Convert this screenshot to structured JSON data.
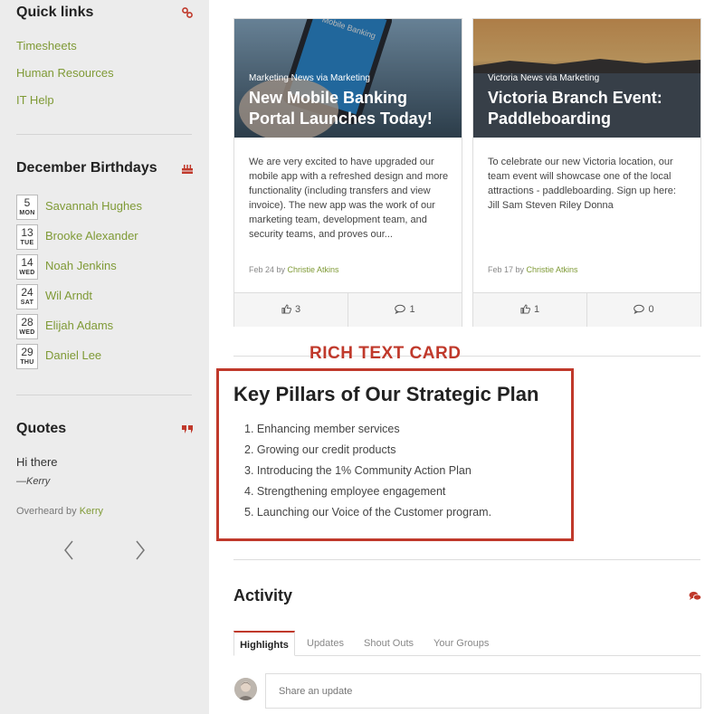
{
  "sidebar": {
    "quick_links": {
      "heading": "Quick links",
      "links": [
        "Timesheets",
        "Human Resources",
        "IT Help"
      ]
    },
    "birthdays": {
      "heading": "December Birthdays",
      "people": [
        {
          "day": "5",
          "weekday": "MON",
          "name": "Savannah Hughes"
        },
        {
          "day": "13",
          "weekday": "TUE",
          "name": "Brooke Alexander"
        },
        {
          "day": "14",
          "weekday": "WED",
          "name": "Noah Jenkins"
        },
        {
          "day": "24",
          "weekday": "SAT",
          "name": "Wil Arndt"
        },
        {
          "day": "28",
          "weekday": "WED",
          "name": "Elijah Adams"
        },
        {
          "day": "29",
          "weekday": "THU",
          "name": "Daniel Lee"
        }
      ]
    },
    "quotes": {
      "heading": "Quotes",
      "text": "Hi there",
      "author": "—Kerry",
      "overheard_prefix": "Overheard by ",
      "overheard_by": "Kerry"
    }
  },
  "news": [
    {
      "source": "Marketing News via Marketing",
      "title": "New Mobile Banking Portal Launches Today!",
      "image_text": "Mobile Banking",
      "body": "We are very excited to have upgraded our mobile app with a refreshed design and more functionality (including transfers and view invoice). The new app was the work of our marketing team, development team, and security teams, and proves our...",
      "date": "Feb 24 by ",
      "author": "Christie Atkins",
      "likes": "3",
      "comments": "1"
    },
    {
      "source": "Victoria News via Marketing",
      "title": "Victoria Branch Event: Paddleboarding",
      "body": "To celebrate our new Victoria location, our team event will showcase one of the local attractions - paddleboarding. Sign up here: Jill Sam Steven Riley Donna",
      "date": "Feb 17 by ",
      "author": "Christie Atkins",
      "likes": "1",
      "comments": "0"
    }
  ],
  "rich_text": {
    "label": "RICH TEXT CARD",
    "title": "Key Pillars of Our Strategic Plan",
    "items": [
      "1. Enhancing member services",
      "2. Growing our credit products",
      "3. Introducing the 1% Community Action Plan",
      "4. Strengthening employee engagement",
      "5. Launching our Voice of the Customer program."
    ]
  },
  "activity": {
    "title": "Activity",
    "tabs": [
      "Highlights",
      "Updates",
      "Shout Outs",
      "Your Groups"
    ],
    "active_tab": "Highlights",
    "share_placeholder": "Share an update"
  },
  "colors": {
    "accent_red": "#c0392b",
    "link_green": "#7f9a36",
    "sidebar_bg": "#ececec"
  }
}
